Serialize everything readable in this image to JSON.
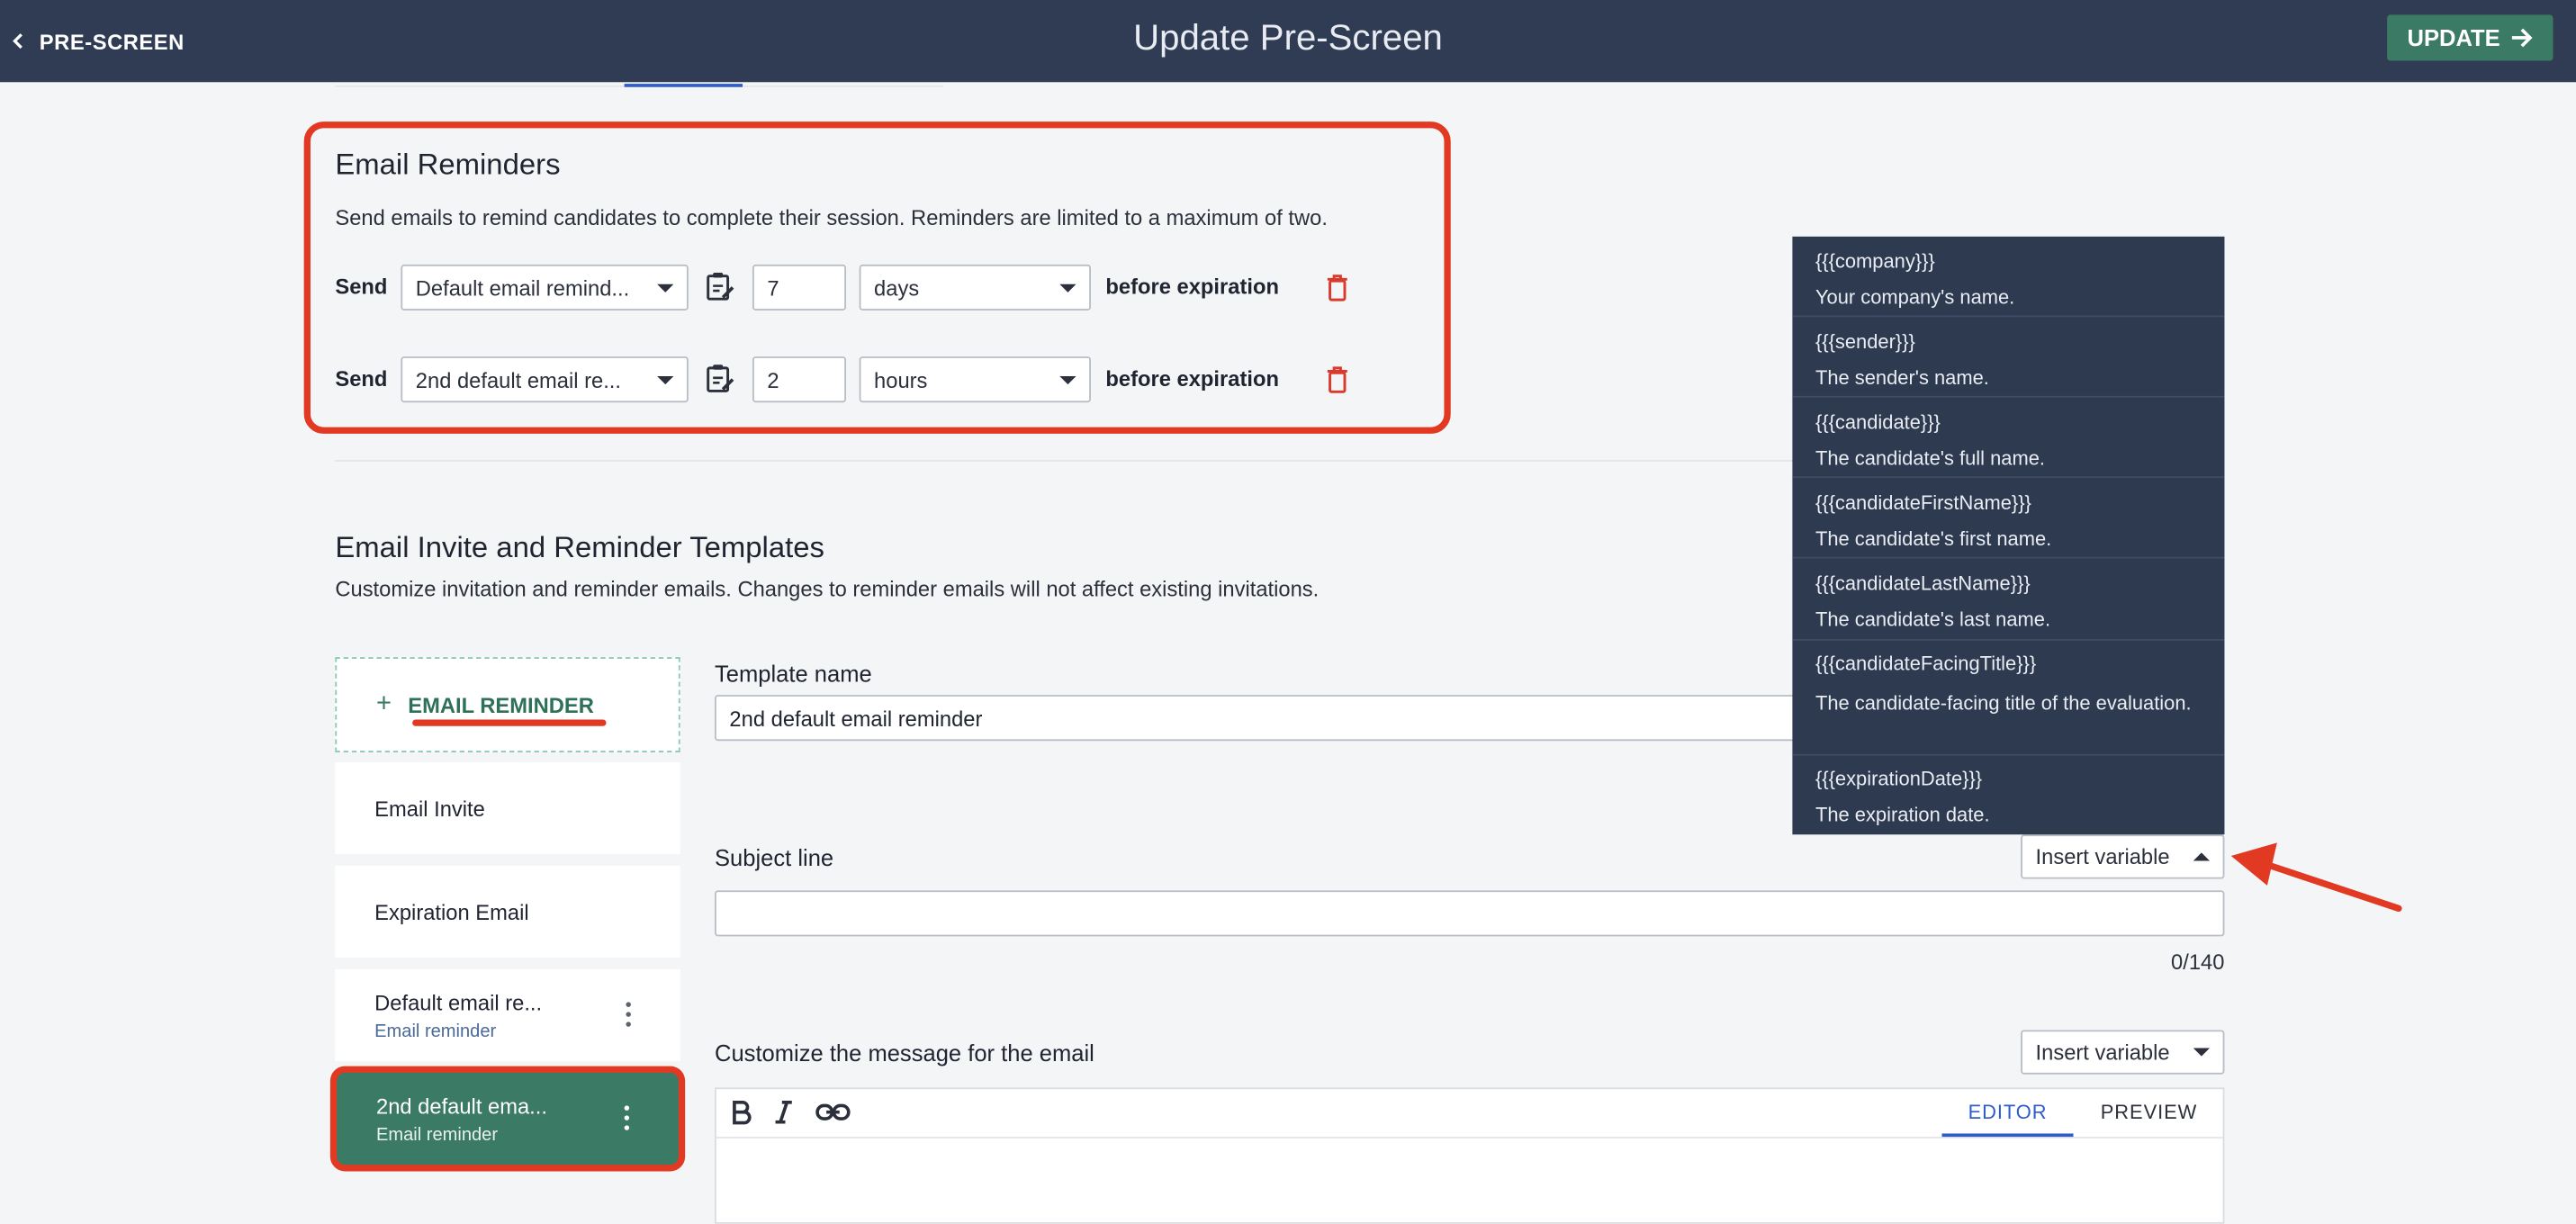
{
  "header": {
    "back_label": "PRE-SCREEN",
    "title": "Update Pre-Screen",
    "update_label": "UPDATE"
  },
  "reminders": {
    "title": "Email Reminders",
    "description": "Send emails to remind candidates to complete their session. Reminders are limited to a maximum of two.",
    "rows": [
      {
        "send_label": "Send",
        "template": "Default email remind...",
        "amount": "7",
        "unit": "days",
        "suffix": "before expiration"
      },
      {
        "send_label": "Send",
        "template": "2nd default email re...",
        "amount": "2",
        "unit": "hours",
        "suffix": "before expiration"
      }
    ]
  },
  "templates": {
    "title": "Email Invite and Reminder Templates",
    "description": "Customize invitation and reminder emails. Changes to reminder emails will not affect existing invitations.",
    "add_label": "EMAIL REMINDER",
    "list": [
      {
        "name": "Email Invite",
        "sub": ""
      },
      {
        "name": "Expiration Email",
        "sub": ""
      },
      {
        "name": "Default email re...",
        "sub": "Email reminder"
      },
      {
        "name": "2nd default ema...",
        "sub": "Email reminder"
      }
    ]
  },
  "form": {
    "template_name_label": "Template name",
    "template_name_value": "2nd default email reminder",
    "subject_label": "Subject line",
    "subject_value": "",
    "subject_counter": "0/140",
    "insert_variable_label": "Insert variable",
    "message_label": "Customize the message for the email",
    "editor_tab": "EDITOR",
    "preview_tab": "PREVIEW"
  },
  "variables": [
    {
      "key": "{{{company}}}",
      "desc": "Your company's name."
    },
    {
      "key": "{{{sender}}}",
      "desc": "The sender's name."
    },
    {
      "key": "{{{candidate}}}",
      "desc": "The candidate's full name."
    },
    {
      "key": "{{{candidateFirstName}}}",
      "desc": "The candidate's first name."
    },
    {
      "key": "{{{candidateLastName}}}",
      "desc": "The candidate's last name."
    },
    {
      "key": "{{{candidateFacingTitle}}}",
      "desc": "The candidate-facing title of the evaluation."
    },
    {
      "key": "{{{expirationDate}}}",
      "desc": "The expiration date."
    }
  ],
  "colors": {
    "header_bg": "#2f3c53",
    "accent_green": "#3b7a64",
    "annotation_red": "#e23a22",
    "menu_bg": "#2e3a50",
    "link_blue": "#2e5ccc"
  }
}
